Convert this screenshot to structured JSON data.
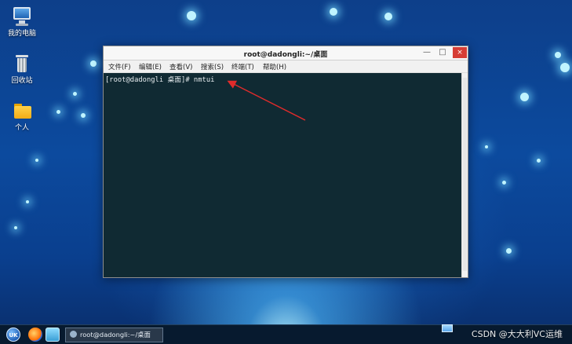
{
  "desktop": {
    "icons": [
      {
        "label": "我的电脑",
        "icon": "computer-icon"
      },
      {
        "label": "回收站",
        "icon": "trash-icon"
      },
      {
        "label": "个人",
        "icon": "folder-icon"
      }
    ]
  },
  "window": {
    "title": "root@dadongli:~/桌面",
    "controls": {
      "minimize": "—",
      "maximize": "□",
      "close": "×"
    },
    "menu": [
      "文件(F)",
      "编辑(E)",
      "查看(V)",
      "搜索(S)",
      "终端(T)",
      "帮助(H)"
    ],
    "terminal_line": "[root@dadongli 桌面]# nmtui"
  },
  "taskbar": {
    "start_label": "UK",
    "task_item": "root@dadongli:~/桌面"
  },
  "watermark": "CSDN @大大利VC运维",
  "colors": {
    "desktop_blue": "#0c4a9e",
    "terminal_bg": "#102a33",
    "close_red": "#d63d35",
    "arrow_red": "#e12b2b"
  }
}
